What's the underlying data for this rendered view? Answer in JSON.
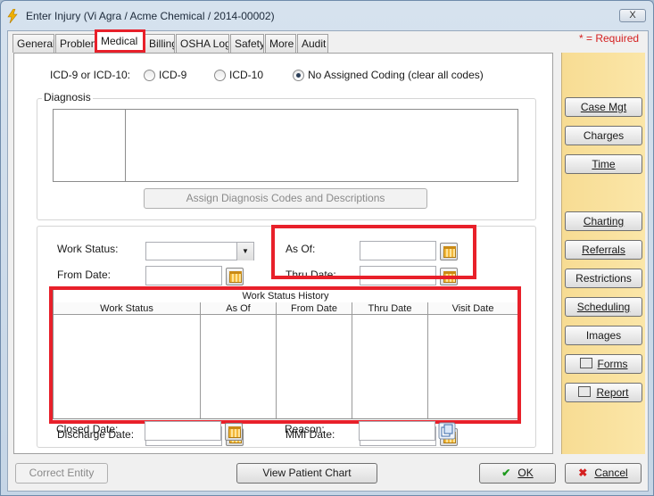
{
  "window": {
    "title": "Enter Injury (Vi Agra / Acme Chemical / 2014-00002)",
    "close_label": "X"
  },
  "tabs": [
    "General",
    "Problem",
    "Medical",
    "Billing",
    "OSHA Log",
    "Safety",
    "More",
    "Audit"
  ],
  "required_note": "* = Required",
  "coding": {
    "label": "ICD-9 or ICD-10:",
    "options": [
      "ICD-9",
      "ICD-10",
      "No Assigned Coding (clear all codes)"
    ],
    "selected": "No Assigned Coding (clear all codes)"
  },
  "diagnosis": {
    "legend": "Diagnosis",
    "assign_button": "Assign Diagnosis Codes and Descriptions"
  },
  "work_status": {
    "work_status_label": "Work Status:",
    "from_date_label": "From Date:",
    "as_of_label": "As Of:",
    "thru_date_label": "Thru Date:",
    "history_title": "Work Status History",
    "history_columns": [
      "Work Status",
      "As Of",
      "From Date",
      "Thru Date",
      "Visit Date"
    ],
    "discharge_date_label": "Discharge Date:",
    "closed_date_label": "Closed Date:",
    "mmi_date_label": "MMI Date:",
    "reason_label": "Reason:"
  },
  "side_buttons": {
    "case_mgt": "Case Mgt",
    "charges": "Charges",
    "time": "Time",
    "charting": "Charting",
    "referrals": "Referrals",
    "restrictions": "Restrictions",
    "scheduling": "Scheduling",
    "images": "Images",
    "forms": "Forms",
    "report": "Report"
  },
  "footer": {
    "correct_entity": "Correct Entity",
    "view_patient_chart": "View Patient Chart",
    "ok": "OK",
    "cancel": "Cancel"
  },
  "colors": {
    "highlight": "#e8202a",
    "side_panel": "#f9e09b",
    "required": "#d42020"
  }
}
